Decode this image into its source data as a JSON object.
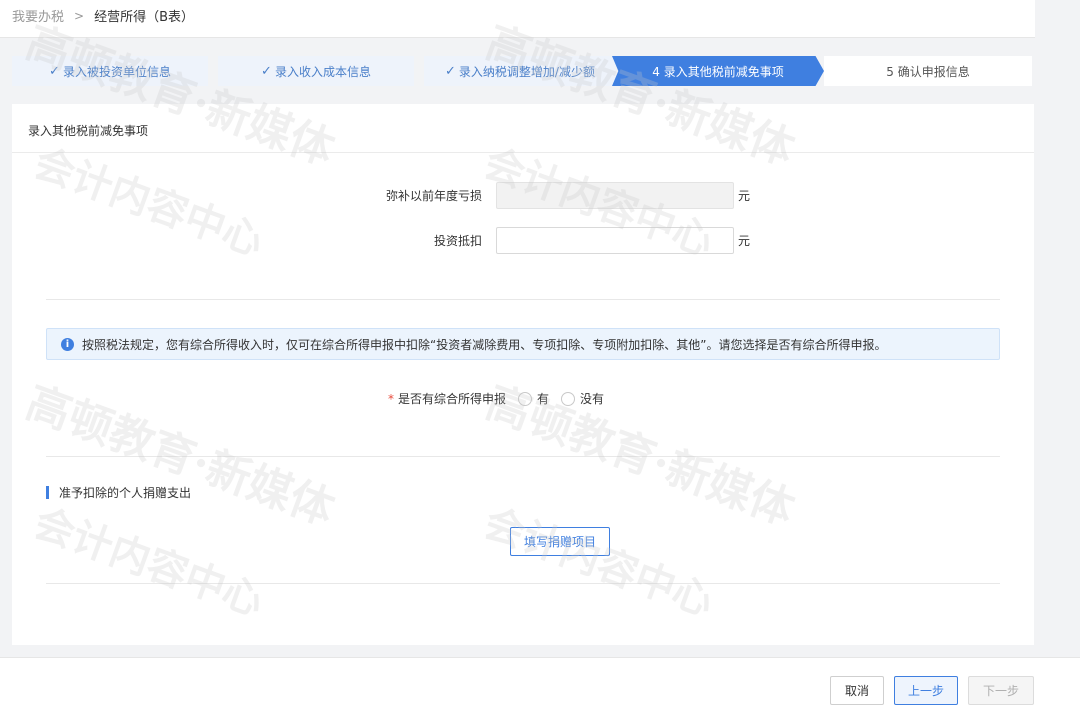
{
  "breadcrumb": {
    "root": "我要办税",
    "separator": ">",
    "current": "经营所得（B表）"
  },
  "steps": [
    {
      "label": "录入被投资单位信息",
      "state": "done"
    },
    {
      "label": "录入收入成本信息",
      "state": "done"
    },
    {
      "label": "录入纳税调整增加/减少额",
      "state": "done"
    },
    {
      "label": "4 录入其他税前减免事项",
      "state": "active"
    },
    {
      "label": "5 确认申报信息",
      "state": "todo"
    }
  ],
  "check_glyph": "✓",
  "panel": {
    "title": "录入其他税前减免事项"
  },
  "fields": {
    "loss_offset": {
      "label": "弥补以前年度亏损",
      "value": "",
      "unit": "元"
    },
    "investment_deduction": {
      "label": "投资抵扣",
      "value": "",
      "unit": "元"
    }
  },
  "notice": {
    "icon": "info-icon",
    "text": "按照税法规定，您有综合所得收入时，仅可在综合所得申报中扣除“投资者减除费用、专项扣除、专项附加扣除、其他”。请您选择是否有综合所得申报。"
  },
  "comprehensive_income": {
    "required_mark": "*",
    "label": "是否有综合所得申报",
    "options": [
      "有",
      "没有"
    ]
  },
  "donation": {
    "section_title": "准予扣除的个人捐赠支出",
    "button_label": "填写捐赠项目"
  },
  "footer": {
    "cancel_label": "取消",
    "prev_label": "上一步",
    "next_label": "下一步"
  },
  "colors": {
    "accent": "#3f7fe0",
    "required": "#e84c3d"
  },
  "watermark": {
    "brand": "高顿教育·新媒体",
    "sub": "会计内容中心"
  }
}
